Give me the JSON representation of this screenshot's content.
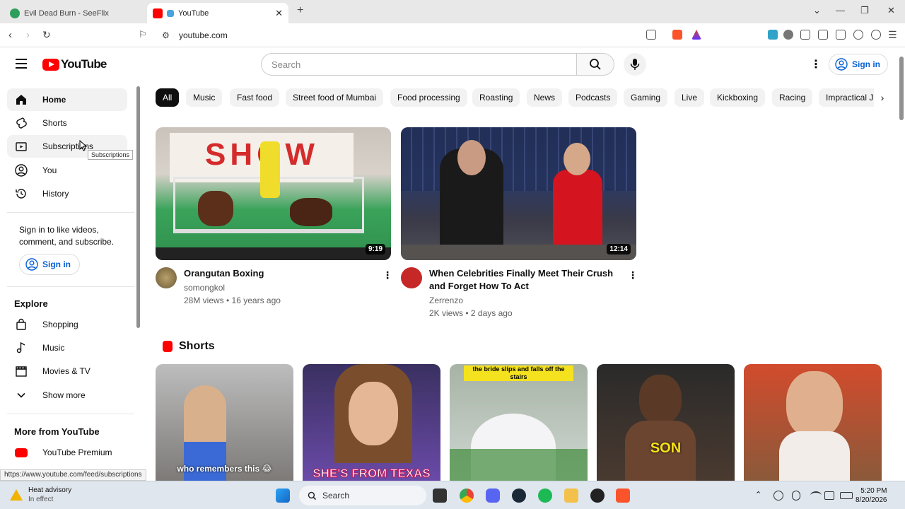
{
  "browser": {
    "tabs": [
      {
        "title": "Evil Dead Burn - SeeFlix"
      },
      {
        "title": "YouTube"
      }
    ],
    "url": "youtube.com",
    "status_url": "https://www.youtube.com/feed/subscriptions"
  },
  "header": {
    "logo_text": "YouTube",
    "search_placeholder": "Search",
    "signin_label": "Sign in"
  },
  "sidebar": {
    "items": [
      {
        "label": "Home"
      },
      {
        "label": "Shorts"
      },
      {
        "label": "Subscriptions"
      },
      {
        "label": "You"
      },
      {
        "label": "History"
      }
    ],
    "signin_note": "Sign in to like videos, comment, and subscribe.",
    "signin_label": "Sign in",
    "explore_heading": "Explore",
    "explore_items": [
      {
        "label": "Shopping"
      },
      {
        "label": "Music"
      },
      {
        "label": "Movies & TV"
      },
      {
        "label": "Show more"
      }
    ],
    "more_heading": "More from YouTube",
    "more_items": [
      {
        "label": "YouTube Premium"
      }
    ],
    "tooltip": "Subscriptions"
  },
  "chips": [
    "All",
    "Music",
    "Fast food",
    "Street food of Mumbai",
    "Food processing",
    "Roasting",
    "News",
    "Podcasts",
    "Gaming",
    "Live",
    "Kickboxing",
    "Racing",
    "Impractical J"
  ],
  "videos": [
    {
      "title": "Orangutan Boxing",
      "channel": "somongkol",
      "meta": "28M views • 16 years ago",
      "duration": "9:19",
      "thumb_text": "SHOW"
    },
    {
      "title": "When Celebrities Finally Meet Their Crush and Forget How To Act",
      "channel": "Zerrenzo",
      "meta": "2K views • 2 days ago",
      "duration": "12:14"
    }
  ],
  "shorts": {
    "heading": "Shorts",
    "items": [
      {
        "caption": "who remembers this 😂"
      },
      {
        "caption": "SHE'S FROM TEXAS"
      },
      {
        "caption": "the bride slips and falls off the stairs"
      },
      {
        "caption": "SON"
      },
      {
        "caption": ""
      }
    ]
  },
  "taskbar": {
    "weather_title": "Heat advisory",
    "weather_sub": "In effect",
    "search": "Search",
    "time": "5:20 PM",
    "date": "8/20/2026"
  }
}
